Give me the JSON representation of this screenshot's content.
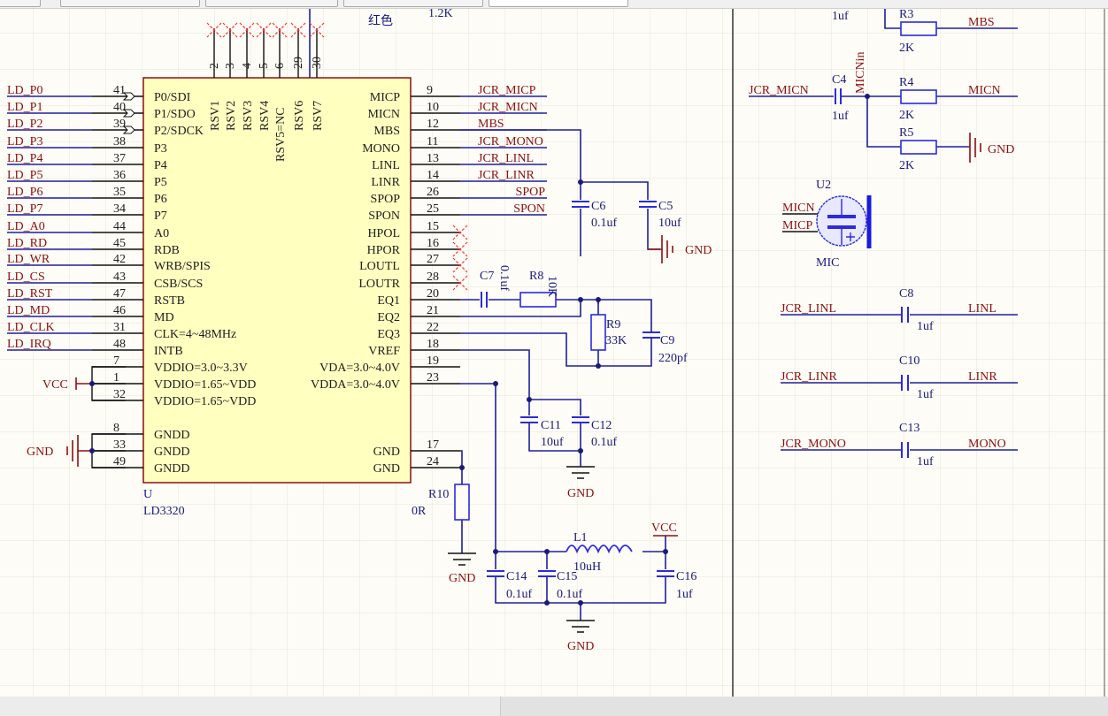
{
  "top_labels": {
    "color_note": "红色",
    "resistor_value": "1.2K"
  },
  "chip": {
    "designator": "U",
    "part": "LD3320",
    "left_pins": [
      {
        "num": "41",
        "name": "P0/SDI",
        "net": "LD_P0"
      },
      {
        "num": "40",
        "name": "P1/SDO",
        "net": "LD_P1"
      },
      {
        "num": "39",
        "name": "P2/SDCK",
        "net": "LD_P2"
      },
      {
        "num": "38",
        "name": "P3",
        "net": "LD_P3"
      },
      {
        "num": "37",
        "name": "P4",
        "net": "LD_P4"
      },
      {
        "num": "36",
        "name": "P5",
        "net": "LD_P5"
      },
      {
        "num": "35",
        "name": "P6",
        "net": "LD_P6"
      },
      {
        "num": "34",
        "name": "P7",
        "net": "LD_P7"
      },
      {
        "num": "44",
        "name": "A0",
        "net": "LD_A0"
      },
      {
        "num": "45",
        "name": "RDB",
        "net": "LD_RD"
      },
      {
        "num": "42",
        "name": "WRB/SPIS",
        "net": "LD_WR"
      },
      {
        "num": "43",
        "name": "CSB/SCS",
        "net": "LD_CS"
      },
      {
        "num": "47",
        "name": "RSTB",
        "net": "LD_RST"
      },
      {
        "num": "46",
        "name": "MD",
        "net": "LD_MD"
      },
      {
        "num": "31",
        "name": "CLK=4~48MHz",
        "net": "LD_CLK"
      },
      {
        "num": "48",
        "name": "INTB",
        "net": "LD_IRQ"
      },
      {
        "num": "7",
        "name": "VDDIO=3.0~3.3V",
        "net": ""
      },
      {
        "num": "1",
        "name": "VDDIO=1.65~VDD",
        "net": ""
      },
      {
        "num": "32",
        "name": "VDDIO=1.65~VDD",
        "net": ""
      },
      {
        "num": "8",
        "name": "GNDD",
        "net": ""
      },
      {
        "num": "33",
        "name": "GNDD",
        "net": ""
      },
      {
        "num": "49",
        "name": "GNDD",
        "net": ""
      }
    ],
    "right_pins": [
      {
        "num": "9",
        "name": "MICP",
        "net": "JCR_MICP"
      },
      {
        "num": "10",
        "name": "MICN",
        "net": "JCR_MICN"
      },
      {
        "num": "12",
        "name": "MBS",
        "net": "MBS"
      },
      {
        "num": "11",
        "name": "MONO",
        "net": "JCR_MONO"
      },
      {
        "num": "13",
        "name": "LINL",
        "net": "JCR_LINL"
      },
      {
        "num": "14",
        "name": "LINR",
        "net": "JCR_LINR"
      },
      {
        "num": "26",
        "name": "SPOP",
        "net": "SPOP"
      },
      {
        "num": "25",
        "name": "SPON",
        "net": "SPON"
      },
      {
        "num": "15",
        "name": "HPOL",
        "net": ""
      },
      {
        "num": "16",
        "name": "HPOR",
        "net": ""
      },
      {
        "num": "27",
        "name": "LOUTL",
        "net": ""
      },
      {
        "num": "28",
        "name": "LOUTR",
        "net": ""
      },
      {
        "num": "20",
        "name": "EQ1",
        "net": ""
      },
      {
        "num": "21",
        "name": "EQ2",
        "net": ""
      },
      {
        "num": "22",
        "name": "EQ3",
        "net": ""
      },
      {
        "num": "18",
        "name": "VREF",
        "net": ""
      },
      {
        "num": "19",
        "name": "VDA=3.0~4.0V",
        "net": ""
      },
      {
        "num": "23",
        "name": "VDDA=3.0~4.0V",
        "net": ""
      },
      {
        "num": "17",
        "name": "GND",
        "net": ""
      },
      {
        "num": "24",
        "name": "GND",
        "net": ""
      }
    ],
    "top_pins": [
      {
        "num": "2",
        "name": "RSV1"
      },
      {
        "num": "3",
        "name": "RSV2"
      },
      {
        "num": "4",
        "name": "RSV3"
      },
      {
        "num": "5",
        "name": "RSV4"
      },
      {
        "num": "6",
        "name": "RSV5=NC"
      },
      {
        "num": "29",
        "name": "RSV6"
      },
      {
        "num": "30",
        "name": "RSV7"
      }
    ]
  },
  "power": {
    "vcc": "VCC",
    "gnd": "GND"
  },
  "components": {
    "c6": {
      "des": "C6",
      "val": "0.1uf"
    },
    "c5": {
      "des": "C5",
      "val": "10uf"
    },
    "c7": {
      "des": "C7",
      "val": "0.1uf"
    },
    "r8": {
      "des": "R8",
      "val": "10K"
    },
    "r9": {
      "des": "R9",
      "val": "33K"
    },
    "c9": {
      "des": "C9",
      "val": "220pf"
    },
    "c11": {
      "des": "C11",
      "val": "10uf"
    },
    "c12": {
      "des": "C12",
      "val": "0.1uf"
    },
    "r10": {
      "des": "R10",
      "val": "0R"
    },
    "l1": {
      "des": "L1",
      "val": "10uH"
    },
    "c14": {
      "des": "C14",
      "val": "0.1uf"
    },
    "c15": {
      "des": "C15",
      "val": "0.1uf"
    },
    "c16": {
      "des": "C16",
      "val": "1uf"
    },
    "c_top": {
      "val": "1uf"
    },
    "r3": {
      "des": "R3",
      "val": "2K"
    },
    "c4": {
      "des": "C4",
      "val": "1uf"
    },
    "r4": {
      "des": "R4",
      "val": "2K"
    },
    "r5": {
      "des": "R5",
      "val": "2K"
    },
    "u2": {
      "des": "U2",
      "val": "MIC"
    },
    "c8": {
      "des": "C8",
      "val": "1uf"
    },
    "c10": {
      "des": "C10",
      "val": "1uf"
    },
    "c13": {
      "des": "C13",
      "val": "1uf"
    }
  },
  "right_panel_nets": {
    "mbs": "MBS",
    "jcr_micn": "JCR_MICN",
    "micnin": "MICNin",
    "micn": "MICN",
    "mic_micn": "MICN",
    "mic_micp": "MICP",
    "jcr_linl": "JCR_LINL",
    "linl": "LINL",
    "jcr_linr": "JCR_LINR",
    "linr": "LINR",
    "jcr_mono": "JCR_MONO",
    "mono": "MONO"
  },
  "colors": {
    "wire": "#1f1f9a",
    "net_label": "#8b1010",
    "chip_fill": "#ffffc0",
    "no_connect": "#ff3030",
    "component": "#2b2bdd"
  }
}
